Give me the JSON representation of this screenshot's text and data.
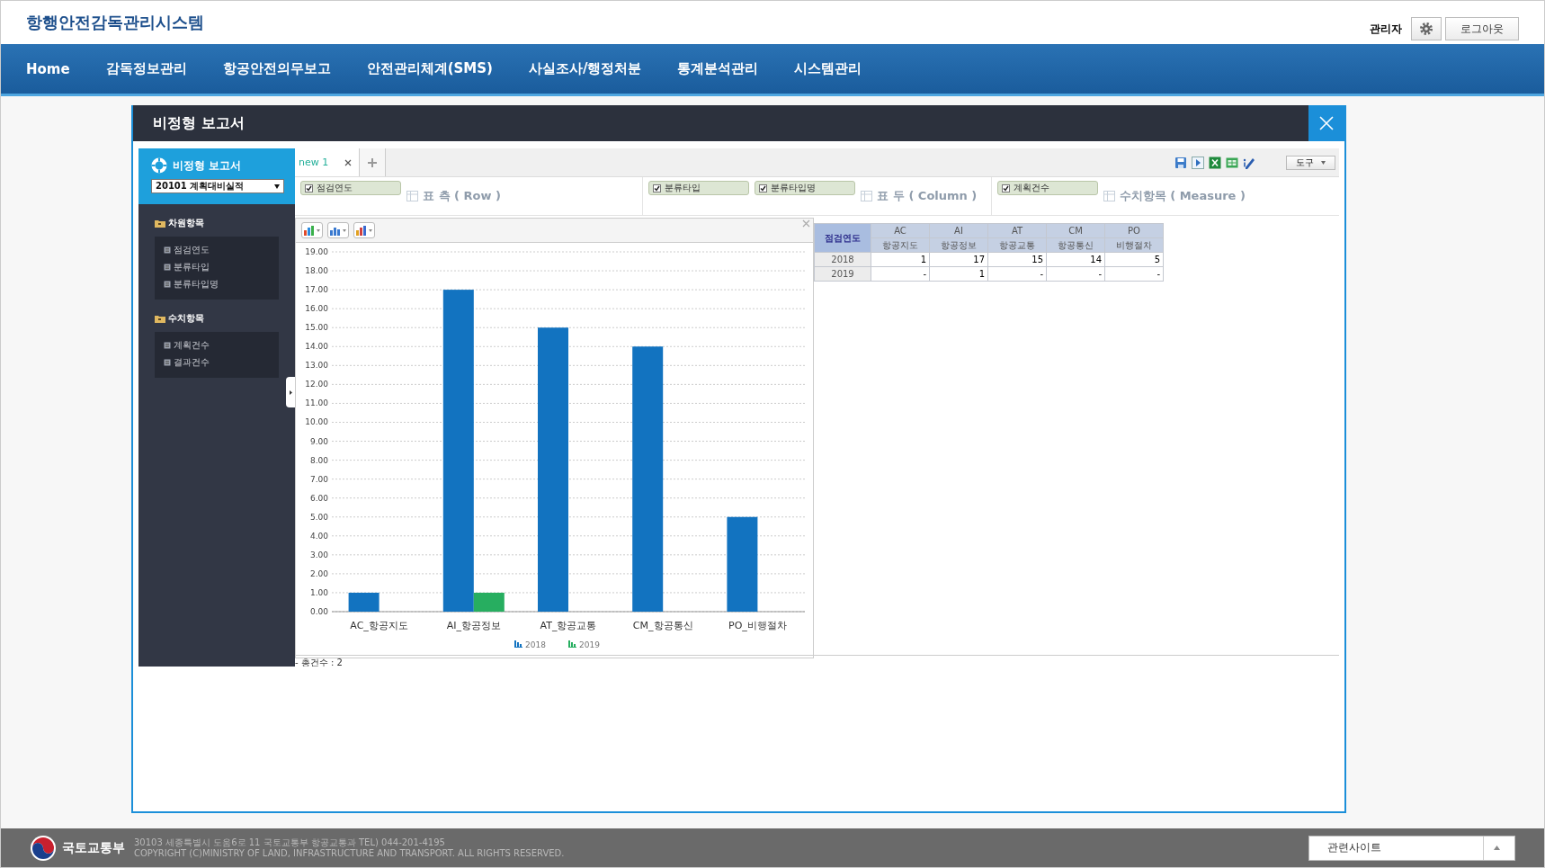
{
  "header": {
    "title": "항행안전감독관리시스템",
    "user": "관리자",
    "logout": "로그아웃"
  },
  "nav": [
    "Home",
    "감독정보관리",
    "항공안전의무보고",
    "안전관리체계(SMS)",
    "사실조사/행정처분",
    "통계분석관리",
    "시스템관리"
  ],
  "dialog": {
    "title": "비정형 보고서"
  },
  "sidebar": {
    "title": "비정형 보고서",
    "report_select": "20101 계획대비실적",
    "groups": [
      {
        "label": "차원항목",
        "items": [
          "점검연도",
          "분류타입",
          "분류타입명"
        ]
      },
      {
        "label": "수치항목",
        "items": [
          "계획건수",
          "결과건수"
        ]
      }
    ]
  },
  "tabs": [
    {
      "label": "new 1",
      "selected": true
    }
  ],
  "tools_button": "도구",
  "zones": [
    {
      "label": "표 측 ( Row )",
      "fields": [
        {
          "label": "점검연도",
          "checked": true
        }
      ]
    },
    {
      "label": "표 두 ( Column )",
      "fields": [
        {
          "label": "분류타입",
          "checked": true
        },
        {
          "label": "분류타입명",
          "checked": true
        }
      ]
    },
    {
      "label": "수치항목 ( Measure )",
      "fields": [
        {
          "label": "계획건수",
          "checked": true
        }
      ]
    }
  ],
  "chart": {
    "chart_data": {
      "type": "bar",
      "categories": [
        "AC_항공지도",
        "AI_항공정보",
        "AT_항공교통",
        "CM_항공통신",
        "PO_비행절차"
      ],
      "series": [
        {
          "name": "2018",
          "color": "#1273c0",
          "values": [
            1,
            17,
            15,
            14,
            5
          ]
        },
        {
          "name": "2019",
          "color": "#27ae60",
          "values": [
            null,
            1,
            null,
            null,
            null
          ]
        }
      ],
      "ylim": [
        0,
        19
      ],
      "grid": true,
      "legend": true,
      "yticks": [
        {
          "value": 0,
          "label": "0.00"
        },
        {
          "value": 1,
          "label": "1.00"
        },
        {
          "value": 2,
          "label": "2.00"
        },
        {
          "value": 3,
          "label": "3.00"
        },
        {
          "value": 4,
          "label": "4.00"
        },
        {
          "value": 5,
          "label": "5.00"
        },
        {
          "value": 6,
          "label": "6.00"
        },
        {
          "value": 7,
          "label": "7.00"
        },
        {
          "value": 8,
          "label": "8.00"
        },
        {
          "value": 9,
          "label": "9.00"
        },
        {
          "value": 10,
          "label": "10.00"
        },
        {
          "value": 11,
          "label": "11.00"
        },
        {
          "value": 12,
          "label": "12.00"
        },
        {
          "value": 13,
          "label": "13.00"
        },
        {
          "value": 14,
          "label": "14.00"
        },
        {
          "value": 15,
          "label": "15.00"
        },
        {
          "value": 16,
          "label": "16.00"
        },
        {
          "value": 17,
          "label": "17.00"
        },
        {
          "value": 18,
          "label": "18.00"
        },
        {
          "value": 19,
          "label": "19.00"
        }
      ]
    }
  },
  "pivot": {
    "corner": "점검연도",
    "columns": [
      {
        "code": "AC",
        "name": "항공지도"
      },
      {
        "code": "AI",
        "name": "항공정보"
      },
      {
        "code": "AT",
        "name": "항공교통"
      },
      {
        "code": "CM",
        "name": "항공통신"
      },
      {
        "code": "PO",
        "name": "비행절차"
      }
    ],
    "rows": [
      {
        "label": "2018",
        "cells": [
          "1",
          "17",
          "15",
          "14",
          "5"
        ]
      },
      {
        "label": "2019",
        "cells": [
          "-",
          "1",
          "-",
          "-",
          "-"
        ]
      }
    ]
  },
  "total": "- 총건수 : 2",
  "footer": {
    "org": "국토교통부",
    "address": "30103 세종특별시 도움6로 11 국토교통부 항공교통과 TEL) 044-201-4195",
    "copyright": "COPYRIGHT (C)MINISTRY OF LAND, INFRASTRUCTURE AND TRANSPORT. ALL RIGHTS RESERVED.",
    "related_select": "관련사이트"
  }
}
